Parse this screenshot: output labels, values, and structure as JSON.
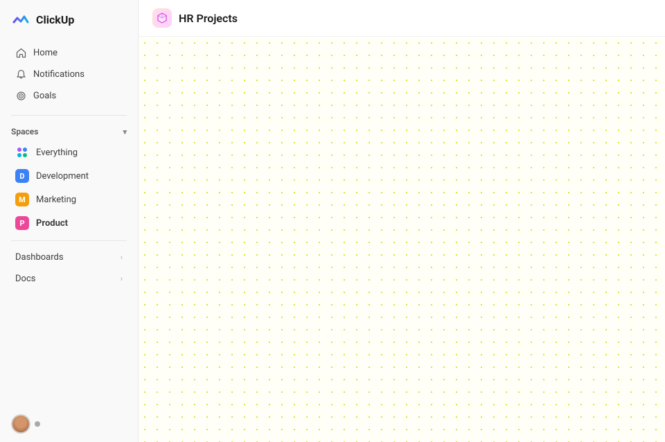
{
  "app": {
    "name": "ClickUp"
  },
  "sidebar": {
    "nav_items": [
      {
        "id": "home",
        "label": "Home",
        "icon": "home-icon"
      },
      {
        "id": "notifications",
        "label": "Notifications",
        "icon": "bell-icon"
      },
      {
        "id": "goals",
        "label": "Goals",
        "icon": "goals-icon"
      }
    ],
    "spaces_label": "Spaces",
    "spaces": [
      {
        "id": "everything",
        "label": "Everything",
        "type": "dots",
        "color1": "#a855f7",
        "color2": "#3b82f6"
      },
      {
        "id": "development",
        "label": "Development",
        "type": "avatar",
        "letter": "D",
        "color": "#3b82f6"
      },
      {
        "id": "marketing",
        "label": "Marketing",
        "type": "avatar",
        "letter": "M",
        "color": "#f59e0b"
      },
      {
        "id": "product",
        "label": "Product",
        "type": "avatar",
        "letter": "P",
        "color": "#ec4899",
        "active": true
      }
    ],
    "expandable_items": [
      {
        "id": "dashboards",
        "label": "Dashboards"
      },
      {
        "id": "docs",
        "label": "Docs"
      }
    ]
  },
  "main": {
    "page_title": "HR Projects",
    "hr_icon": "📦"
  }
}
